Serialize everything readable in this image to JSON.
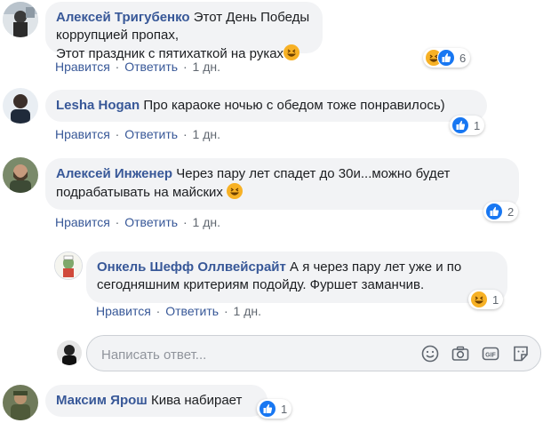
{
  "comments": [
    {
      "author": "Алексей Тригубенко",
      "text_line1": "Этот День Победы коррупцией пропах,",
      "text_line2": "Этот праздник с пятихаткой на руках",
      "like_label": "Нравится",
      "reply_label": "Ответить",
      "time": "1 дн.",
      "reaction_count": "6"
    },
    {
      "author": "Lesha Hogan",
      "text_line1": "Про караоке ночью с обедом тоже понравилось)",
      "like_label": "Нравится",
      "reply_label": "Ответить",
      "time": "1 дн.",
      "reaction_count": "1"
    },
    {
      "author": "Алексей Инженер",
      "text_line1": "Через пару лет спадет до 30и...можно будет",
      "text_line2": "подрабатывать на майских",
      "like_label": "Нравится",
      "reply_label": "Ответить",
      "time": "1 дн.",
      "reaction_count": "2"
    },
    {
      "author": "Онкель Шефф Оллвейсрайт",
      "text_line1": "А я через пару лет уже и по",
      "text_line2": "сегодняшним критериям подойду. Фуршет заманчив.",
      "like_label": "Нравится",
      "reply_label": "Ответить",
      "time": "1 дн.",
      "reaction_count": "1"
    },
    {
      "author": "Максим Ярош",
      "text_line1": "Кива набирает",
      "reaction_count": "1"
    }
  ],
  "reply_input": {
    "placeholder": "Написать ответ..."
  },
  "icons": [
    "emoji-icon",
    "camera-icon",
    "gif-icon",
    "sticker-icon",
    "haha-icon",
    "like-icon"
  ],
  "colors": {
    "author": "#385898",
    "bubble": "#f2f3f5",
    "like": "#1877f2",
    "haha": "#f7b125"
  }
}
